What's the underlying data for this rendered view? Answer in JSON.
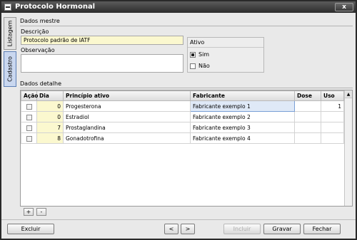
{
  "window": {
    "title": "Protocolo Hormonal",
    "close_label": "x"
  },
  "side_tabs": {
    "listagem": "Listagem",
    "cadastro": "Cadastro"
  },
  "master": {
    "section_label": "Dados mestre",
    "descricao_label": "Descrição",
    "descricao_value": "Protocolo padrão de IATF",
    "observacao_label": "Observação",
    "observacao_value": "",
    "ativo": {
      "title": "Ativo",
      "options": [
        {
          "label": "Sim",
          "selected": true
        },
        {
          "label": "Não",
          "selected": false
        }
      ]
    }
  },
  "detail": {
    "section_label": "Dados detalhe",
    "columns": [
      "Ação",
      "Dia",
      "Princípio ativo",
      "Fabricante",
      "Dose",
      "Uso"
    ],
    "rows": [
      {
        "dia": "0",
        "principio": "Progesterona",
        "fabricante": "Fabricante exemplo 1",
        "dose": "",
        "uso": "1"
      },
      {
        "dia": "0",
        "principio": "Estradiol",
        "fabricante": "Fabricante exemplo 2",
        "dose": "",
        "uso": ""
      },
      {
        "dia": "7",
        "principio": "Prostaglandina",
        "fabricante": "Fabricante exemplo 3",
        "dose": "",
        "uso": ""
      },
      {
        "dia": "8",
        "principio": "Gonadotrofina",
        "fabricante": "Fabricante exemplo 4",
        "dose": "",
        "uso": ""
      }
    ],
    "add_label": "+",
    "remove_label": "-"
  },
  "footer": {
    "excluir": "Excluir",
    "prev": "<",
    "next": ">",
    "incluir": "Incluir",
    "gravar": "Gravar",
    "fechar": "Fechar"
  }
}
